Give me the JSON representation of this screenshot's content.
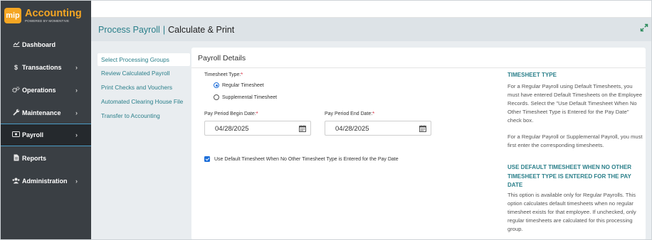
{
  "logo": {
    "badge": "mip",
    "title": "Accounting",
    "subtitle": "POWERED BY MOMENTIVE"
  },
  "sidebar": {
    "items": [
      {
        "label": "Dashboard",
        "icon": "chart-line-icon",
        "chevron": ""
      },
      {
        "label": "Transactions",
        "icon": "dollar-icon",
        "chevron": "›"
      },
      {
        "label": "Operations",
        "icon": "cogs-icon",
        "chevron": "›"
      },
      {
        "label": "Maintenance",
        "icon": "wrench-icon",
        "chevron": "›"
      },
      {
        "label": "Payroll",
        "icon": "money-icon",
        "chevron": "›"
      },
      {
        "label": "Reports",
        "icon": "file-icon",
        "chevron": ""
      },
      {
        "label": "Administration",
        "icon": "users-icon",
        "chevron": "›"
      }
    ],
    "active": "Payroll"
  },
  "header": {
    "breadcrumb_link": "Process Payroll",
    "separator": "|",
    "current": "Calculate & Print"
  },
  "subnav": {
    "items": [
      {
        "label": "Select Processing Groups"
      },
      {
        "label": "Review Calculated Payroll"
      },
      {
        "label": "Print Checks and Vouchers"
      },
      {
        "label": "Automated Clearing House File"
      },
      {
        "label": "Transfer to Accounting"
      }
    ],
    "active": "Select Processing Groups"
  },
  "panel": {
    "title": "Payroll Details",
    "timesheet_type_label": "Timesheet Type:",
    "required_mark": "*",
    "radio_regular": "Regular Timesheet",
    "radio_supplemental": "Supplemental Timesheet",
    "selected_radio": "Regular Timesheet",
    "begin_date_label": "Pay Period Begin Date:",
    "begin_date_value": "04/28/2025",
    "end_date_label": "Pay Period End Date:",
    "end_date_value": "04/28/2025",
    "checkbox_label": "Use Default Timesheet When No Other Timesheet Type is Entered for the Pay Date",
    "checkbox_checked": true
  },
  "help": {
    "heading1": "TIMESHEET TYPE",
    "para1": "For a Regular Payroll using Default Timesheets, you must have entered Default Timesheets on the Employee Records. Select the \"Use Default Timesheet When No Other Timesheet Type is Entered for the Pay Date\" check box.",
    "para2": "For a Regular Payroll or Supplemental Payroll, you must first enter the corresponding timesheets.",
    "heading2": "USE DEFAULT TIMESHEET WHEN NO OTHER TIMESHEET TYPE IS ENTERED FOR THE PAY DATE",
    "para3": "This option is available only for Regular Payrolls. This option calculates default timesheets when no regular timesheet exists for that employee. If unchecked, only regular timesheets are calculated for this processing group."
  },
  "colors": {
    "sidebar_bg": "#3a3f44",
    "brand_orange": "#f5a623",
    "link_teal": "#2a7f8a",
    "accent_blue": "#1e6fd9",
    "title_bar_bg": "#dde3e7"
  }
}
